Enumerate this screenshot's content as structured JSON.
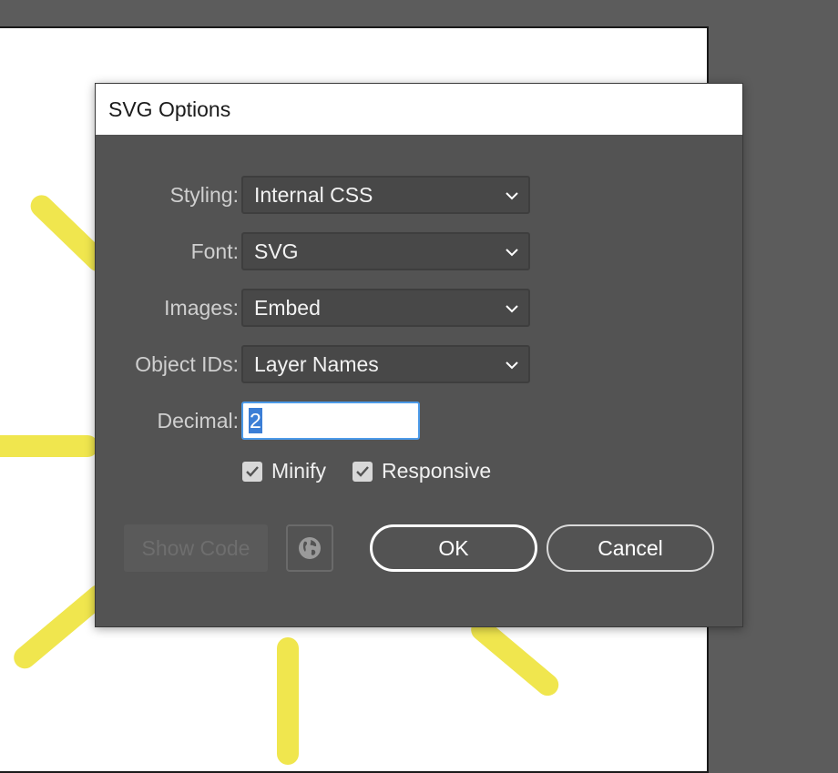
{
  "canvas": {
    "accent_color": "#f0e64e",
    "artboard_color": "#ffffff",
    "pasteboard_color": "#5c5c5c"
  },
  "dialog": {
    "title": "SVG Options",
    "fields": {
      "styling": {
        "label": "Styling:",
        "value": "Internal CSS"
      },
      "font": {
        "label": "Font:",
        "value": "SVG"
      },
      "images": {
        "label": "Images:",
        "value": "Embed"
      },
      "object_ids": {
        "label": "Object IDs:",
        "value": "Layer Names"
      },
      "decimal": {
        "label": "Decimal:",
        "value": "2"
      }
    },
    "checkboxes": {
      "minify": {
        "label": "Minify",
        "checked": true
      },
      "responsive": {
        "label": "Responsive",
        "checked": true
      }
    },
    "buttons": {
      "show_code": "Show Code",
      "ok": "OK",
      "cancel": "Cancel"
    },
    "icons": {
      "dropdown": "chevron-down-icon",
      "web": "globe-icon",
      "check": "checkmark-icon"
    }
  }
}
